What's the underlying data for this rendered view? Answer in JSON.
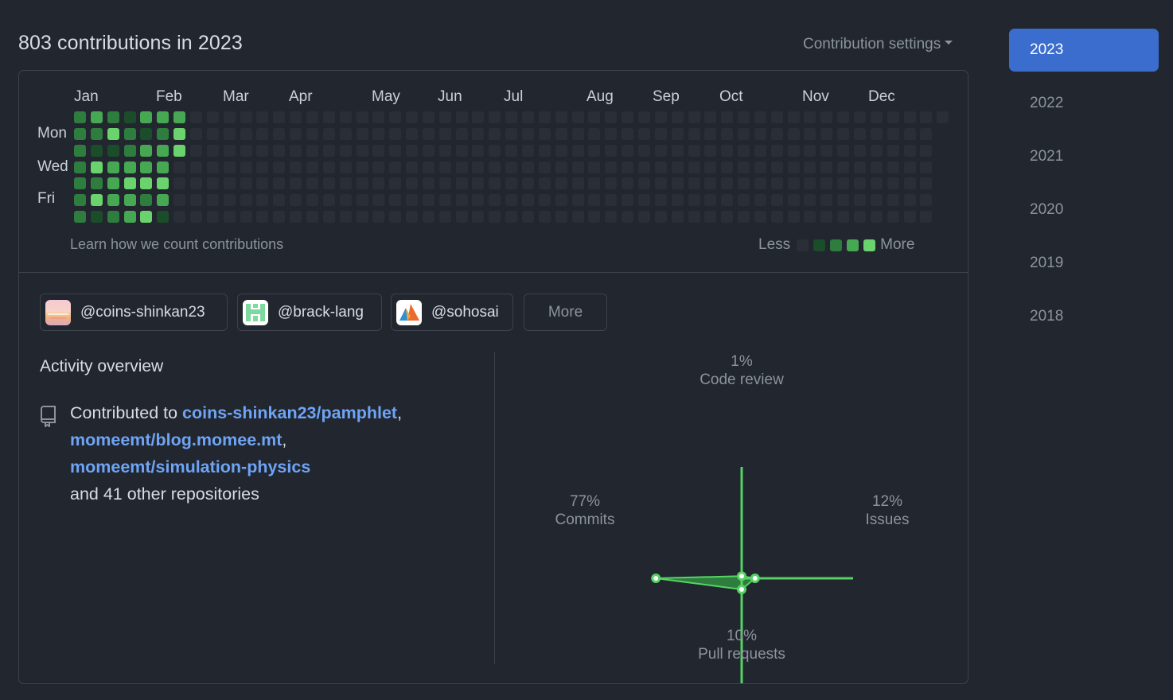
{
  "header": {
    "title": "803 contributions in 2023",
    "settings_label": "Contribution settings"
  },
  "calendar": {
    "months": [
      "Jan",
      "Feb",
      "Mar",
      "Apr",
      "May",
      "Jun",
      "Jul",
      "Aug",
      "Sep",
      "Oct",
      "Nov",
      "Dec"
    ],
    "weekdays": [
      "Mon",
      "Wed",
      "Fri"
    ],
    "level_colors": [
      "#2a2f37",
      "#1b4d2a",
      "#2e7d3f",
      "#46a852",
      "#6bd36d"
    ],
    "active_weeks": [
      [
        2,
        2,
        2,
        2,
        2,
        2,
        2
      ],
      [
        3,
        2,
        1,
        4,
        2,
        4,
        1
      ],
      [
        2,
        4,
        1,
        3,
        3,
        3,
        2
      ],
      [
        1,
        2,
        2,
        3,
        4,
        3,
        3
      ],
      [
        3,
        1,
        3,
        3,
        4,
        2,
        4
      ],
      [
        3,
        2,
        3,
        3,
        4,
        3,
        1
      ],
      [
        3,
        4,
        4,
        0,
        0,
        0,
        0
      ]
    ],
    "learn_link": "Learn how we count contributions",
    "legend_less": "Less",
    "legend_more": "More"
  },
  "orgs": [
    {
      "handle": "@coins-shinkan23",
      "icon": "coins-shinkan23-avatar"
    },
    {
      "handle": "@brack-lang",
      "icon": "brack-lang-avatar"
    },
    {
      "handle": "@sohosai",
      "icon": "sohosai-avatar"
    }
  ],
  "more_label": "More",
  "activity": {
    "title": "Activity overview",
    "prefix": "Contributed to",
    "repos": [
      "coins-shinkan23/pamphlet",
      "momeemt/blog.momee.mt",
      "momeemt/simulation-physics"
    ],
    "suffix": "and 41 other repositories",
    "icon": "repo-icon"
  },
  "radar": {
    "code_review": {
      "pct": "1%",
      "label": "Code review",
      "value": 1
    },
    "issues": {
      "pct": "12%",
      "label": "Issues",
      "value": 12
    },
    "pull_requests": {
      "pct": "10%",
      "label": "Pull requests",
      "value": 10
    },
    "commits": {
      "pct": "77%",
      "label": "Commits",
      "value": 77
    },
    "accent": "#56d364"
  },
  "years": [
    "2023",
    "2022",
    "2021",
    "2020",
    "2019",
    "2018"
  ],
  "selected_year": "2023"
}
